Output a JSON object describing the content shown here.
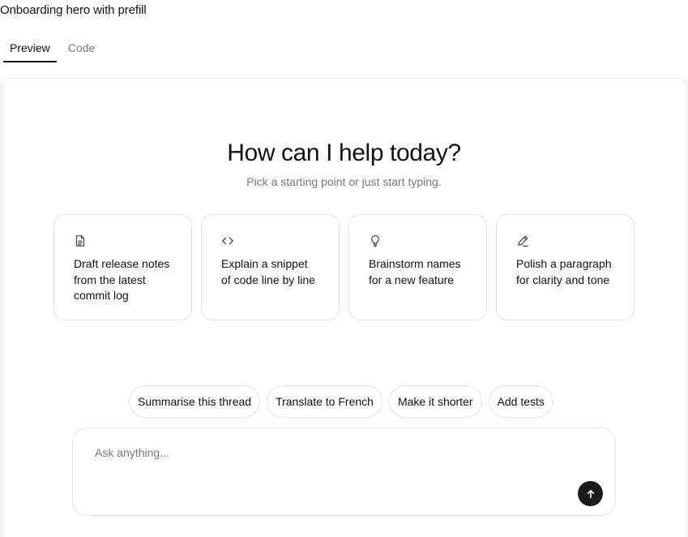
{
  "page": {
    "title": "Onboarding hero with prefill"
  },
  "tabs": [
    {
      "label": "Preview",
      "active": true
    },
    {
      "label": "Code",
      "active": false
    }
  ],
  "hero": {
    "title": "How can I help today?",
    "subtitle": "Pick a starting point or just start typing."
  },
  "cards": [
    {
      "icon": "document-icon",
      "lines": [
        "Draft release notes",
        "from the latest",
        "commit log"
      ]
    },
    {
      "icon": "code-icon",
      "lines": [
        "Explain a snippet",
        "of code line by line"
      ]
    },
    {
      "icon": "lightbulb-icon",
      "lines": [
        "Brainstorm names",
        "for a new feature"
      ]
    },
    {
      "icon": "pencil-icon",
      "lines": [
        "Polish a paragraph",
        "for clarity and tone"
      ]
    }
  ],
  "chips": [
    {
      "label": "Summarise this thread"
    },
    {
      "label": "Translate to French"
    },
    {
      "label": "Make it shorter"
    },
    {
      "label": "Add tests"
    }
  ],
  "composer": {
    "placeholder": "Ask anything...",
    "send_icon": "arrow-up-icon"
  },
  "colors": {
    "text": "#111111",
    "muted": "#777777",
    "border": "#e3e3e3",
    "send_button": "#1a1a1a",
    "background": "#ffffff"
  }
}
